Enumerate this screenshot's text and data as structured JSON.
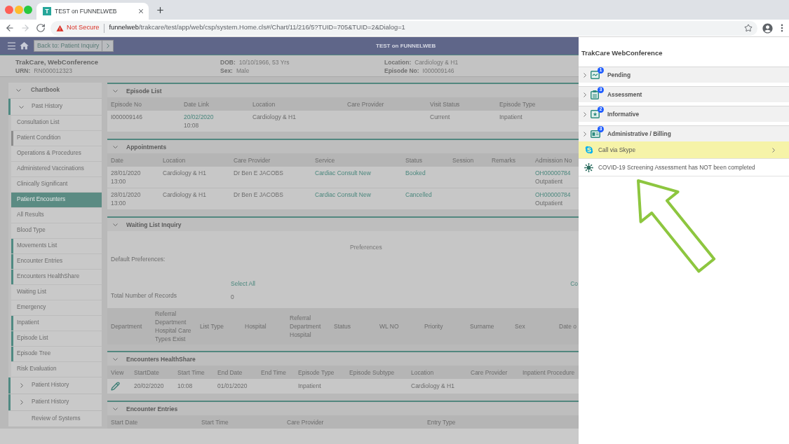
{
  "browser": {
    "tab": {
      "favicon_letter": "T",
      "title": "TEST on FUNNELWEB"
    },
    "nav": [
      {
        "kind": "back",
        "disabled": false
      },
      {
        "kind": "forward",
        "disabled": true
      },
      {
        "kind": "reload",
        "disabled": false
      }
    ],
    "security_label": "Not Secure",
    "url_host": "funnelweb",
    "url_path": "/trakcare/test/app/web/csp/system.Home.cls#/Chart/11/216/5?TUID=705&TUID=2&Dialog=1"
  },
  "header": {
    "back_button": "Back to: Patient Inquiry",
    "title": "TEST on FUNNELWEB"
  },
  "patient_banner": {
    "name": "TrakCare, WebConference",
    "columns": [
      {
        "fields": [
          {
            "label": "URN:",
            "value": "RN000012323"
          }
        ]
      },
      {
        "fields": [
          {
            "label": "DOB:",
            "value": "10/10/1966, 53 Yrs"
          },
          {
            "label": "Sex:",
            "value": "Male"
          }
        ]
      },
      {
        "fields": [
          {
            "label": "Location:",
            "value": "Cardiology & H1"
          },
          {
            "label": "Episode No:",
            "value": "I000009146"
          }
        ]
      }
    ]
  },
  "sidebar": {
    "tree": [
      {
        "label": "Chartbook",
        "expanded": true,
        "children": [
          {
            "label": "Past History",
            "expanded": true,
            "color": "#4f8a82",
            "children": [
              {
                "label": "Consultation List",
                "selected": false
              },
              {
                "label": "Patient Condition",
                "selected": false,
                "color": "#8c8c8c"
              },
              {
                "label": "Operations & Procedures",
                "selected": false
              },
              {
                "label": "Administered Vaccinations",
                "selected": false
              },
              {
                "label": "Clinically Significant",
                "selected": false
              },
              {
                "label": "Patient Encounters",
                "selected": true
              },
              {
                "label": "All Results",
                "selected": false
              },
              {
                "label": "Blood Type",
                "selected": false
              },
              {
                "label": "Movements List",
                "selected": false,
                "color": "#4f8a82"
              },
              {
                "label": "Encounter Entries",
                "selected": false,
                "color": "#4f8a82"
              },
              {
                "label": "Encounters HealthShare",
                "selected": false,
                "color": "#4f8a82"
              },
              {
                "label": "Waiting List",
                "selected": false
              },
              {
                "label": "Emergency",
                "selected": false
              },
              {
                "label": "Inpatient",
                "selected": false,
                "color": "#4f8a82"
              },
              {
                "label": "Episode List",
                "selected": false,
                "color": "#4f8a82"
              },
              {
                "label": "Episode Tree",
                "selected": false,
                "color": "#4f8a82"
              },
              {
                "label": "Risk Evaluation",
                "selected": false
              }
            ]
          },
          {
            "label": "Patient History",
            "expanded": false,
            "color": "#4f8a82"
          },
          {
            "label": "Patient History",
            "expanded": false,
            "color": "#4f8a82"
          },
          {
            "label": "Review of Systems"
          }
        ]
      }
    ]
  },
  "sections": [
    {
      "kind": "table",
      "title": "Episode List",
      "expanded": true,
      "columns": [
        "Episode No",
        "Date Link",
        "Location",
        "Care Provider",
        "Visit Status",
        "Episode Type"
      ],
      "rows": [
        [
          {
            "kind": "text",
            "text": "I000009146"
          },
          {
            "kind": "link",
            "text": "20/02/2020",
            "sub": "10:08"
          },
          {
            "kind": "text",
            "text": "Cardiology & H1"
          },
          null,
          {
            "kind": "text",
            "text": "Current"
          },
          {
            "kind": "text",
            "text": "Inpatient"
          }
        ]
      ]
    },
    {
      "kind": "table",
      "title": "Appointments",
      "expanded": true,
      "columns": [
        "Date",
        "Location",
        "Care Provider",
        "Service",
        "Status",
        "Session",
        "Remarks",
        "Admission No"
      ],
      "rows": [
        [
          {
            "kind": "text",
            "text": "28/01/2020",
            "sub": "13:00"
          },
          {
            "kind": "text",
            "text": "Cardiology & H1"
          },
          {
            "kind": "text",
            "text": "Dr Ben E JACOBS"
          },
          {
            "kind": "link",
            "text": "Cardiac Consult New"
          },
          {
            "kind": "link",
            "text": "Booked"
          },
          null,
          null,
          {
            "kind": "link",
            "text": "OH00000784",
            "sub": "Outpatient"
          }
        ],
        [
          {
            "kind": "text",
            "text": "28/01/2020",
            "sub": "13:00"
          },
          {
            "kind": "text",
            "text": "Cardiology & H1"
          },
          {
            "kind": "text",
            "text": "Dr Ben E JACOBS"
          },
          {
            "kind": "link",
            "text": "Cardiac Consult New"
          },
          {
            "kind": "link",
            "text": "Cancelled"
          },
          null,
          null,
          {
            "kind": "link",
            "text": "OH00000784",
            "sub": "Outpatient"
          }
        ]
      ]
    },
    {
      "kind": "inquiry",
      "title": "Waiting List Inquiry",
      "expanded": true,
      "preferences_heading": "Preferences",
      "default_label": "Default Preferences:",
      "select_all": "Select All",
      "right_link": "Co",
      "total_label": "Total Number of Records",
      "total_value": "0",
      "columns": [
        "Department",
        "Referral Department Hospital Care Types Exist",
        "List Type",
        "Hospital",
        "Referral Department Hospital",
        "Status",
        "WL NO",
        "Priority",
        "Surname",
        "Sex",
        "Date o"
      ]
    },
    {
      "kind": "table",
      "title": "Encounters HealthShare",
      "expanded": true,
      "columns": [
        "View",
        "StartDate",
        "Start Time",
        "End Date",
        "End Time",
        "Episode Type",
        "Episode Subtype",
        "Location",
        "Care Provider",
        "Inpatient Procedure"
      ],
      "rows": [
        [
          {
            "kind": "edit"
          },
          {
            "kind": "text",
            "text": "20/02/2020"
          },
          {
            "kind": "text",
            "text": "10:08"
          },
          {
            "kind": "text",
            "text": "01/01/2020"
          },
          null,
          {
            "kind": "text",
            "text": "Inpatient"
          },
          null,
          {
            "kind": "text",
            "text": "Cardiology & H1"
          },
          null,
          null
        ]
      ]
    },
    {
      "kind": "table",
      "title": "Encounter Entries",
      "expanded": true,
      "columns": [
        "Start Date",
        "Start Time",
        "Care Provider",
        "Entry Type"
      ]
    }
  ],
  "panel": {
    "title": "TrakCare WebConference",
    "groups": [
      {
        "label": "Pending",
        "count": "1",
        "expanded": false
      },
      {
        "label": "Assessment",
        "count": "3",
        "expanded": false
      },
      {
        "label": "Informative",
        "count": "2",
        "expanded": false
      },
      {
        "label": "Administrative / Billing",
        "count": "3",
        "expanded": false
      }
    ],
    "items": [
      {
        "kind": "skype",
        "label": "Call via Skype",
        "highlighted": true
      },
      {
        "kind": "alert",
        "label": "COVID-19 Screening Assessment has NOT been completed",
        "highlighted": false
      }
    ]
  }
}
